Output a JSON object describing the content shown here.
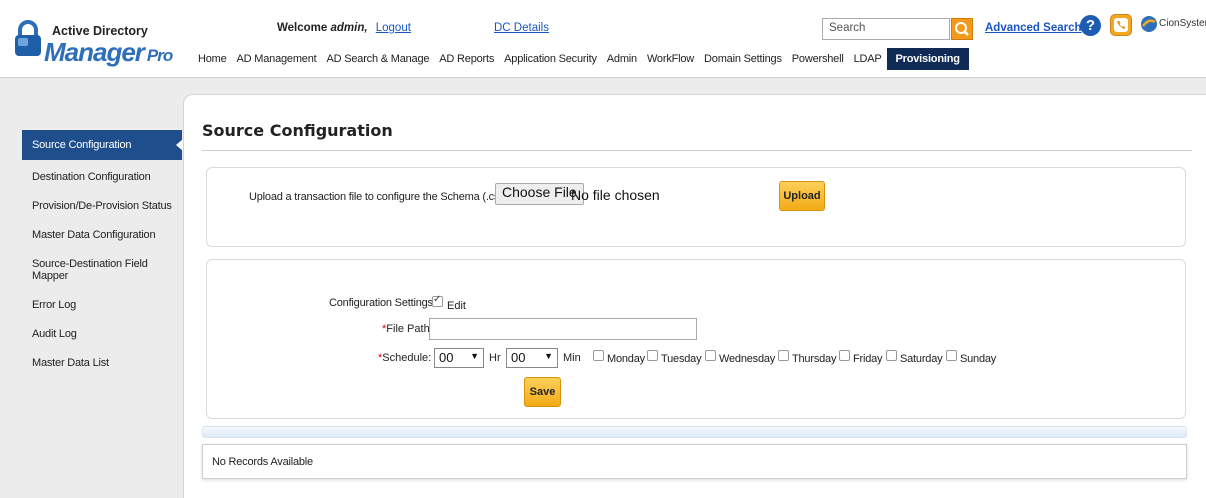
{
  "header": {
    "logo_line1": "Active Directory",
    "logo_line2": "Manager",
    "logo_pro": "Pro",
    "welcome_prefix": "Welcome",
    "user": "admin,",
    "logout": "Logout",
    "dc_details": "DC Details",
    "search_placeholder": "Search",
    "advanced_search": "Advanced Search",
    "brand": "CionSystems",
    "accent_color": "#1e4f8c",
    "button_color": "#f2ab16"
  },
  "nav": {
    "items": [
      "Home",
      "AD Management",
      "AD Search & Manage",
      "AD Reports",
      "Application Security",
      "Admin",
      "WorkFlow",
      "Domain Settings",
      "Powershell",
      "LDAP",
      "Provisioning"
    ],
    "active": "Provisioning"
  },
  "sidebar": {
    "items": [
      "Source Configuration",
      "Destination Configuration",
      "Provision/De-Provision Status",
      "Master Data Configuration",
      "Source-Destination Field Mapper",
      "Error Log",
      "Audit Log",
      "Master Data List"
    ],
    "active": "Source Configuration"
  },
  "main": {
    "title": "Source Configuration",
    "upload_label": "Upload a transaction file to configure the Schema (.csv):",
    "choose_file": "Choose File",
    "no_file": "No file chosen",
    "upload_button": "Upload",
    "config_label": "Configuration Settings:",
    "edit_label": "Edit",
    "edit_checked": true,
    "file_path_label": "File Path:",
    "file_path_value": "",
    "schedule_label": "Schedule:",
    "hour_value": "00",
    "hour_unit": "Hr",
    "minute_value": "00",
    "minute_unit": "Min",
    "days": [
      "Monday",
      "Tuesday",
      "Wednesday",
      "Thursday",
      "Friday",
      "Saturday",
      "Sunday"
    ],
    "save_button": "Save",
    "no_records": "No Records Available"
  }
}
